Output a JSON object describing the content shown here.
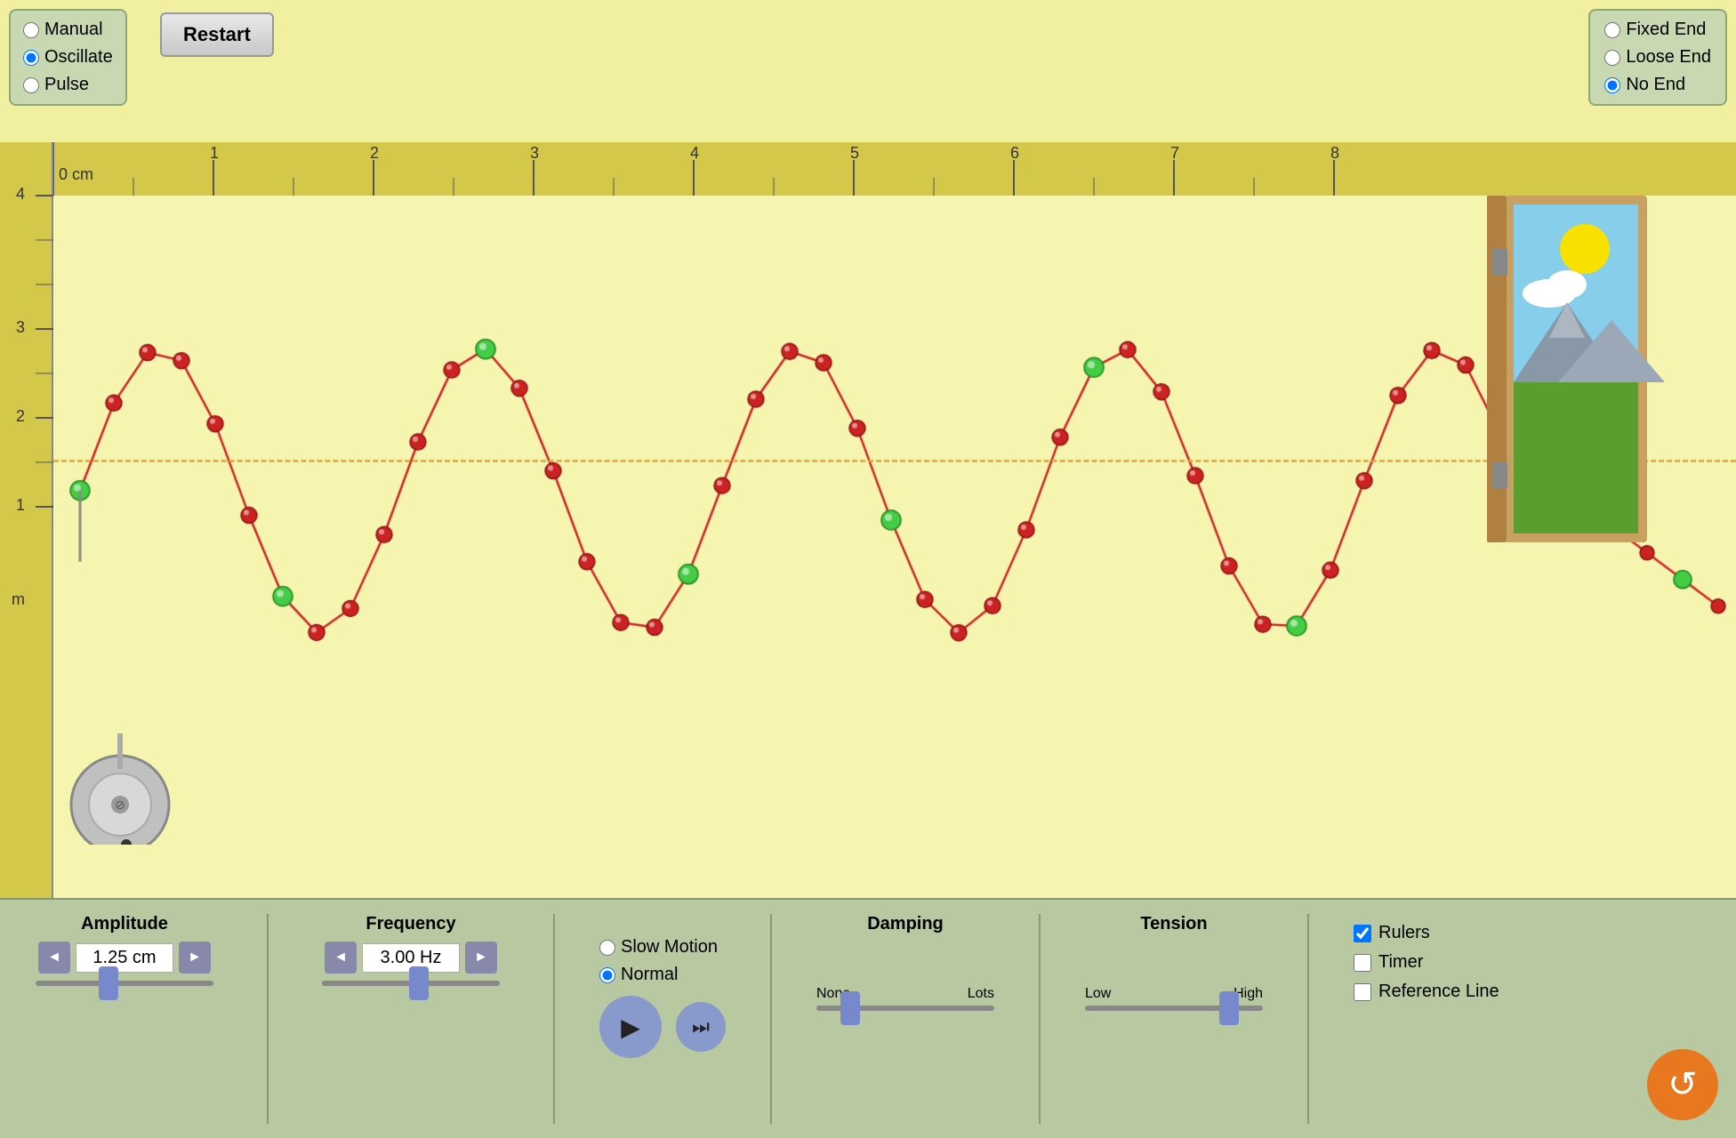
{
  "topLeft": {
    "options": [
      {
        "label": "Manual",
        "value": "manual",
        "checked": false
      },
      {
        "label": "Oscillate",
        "value": "oscillate",
        "checked": true
      },
      {
        "label": "Pulse",
        "value": "pulse",
        "checked": false
      }
    ]
  },
  "restart": {
    "label": "Restart"
  },
  "topRight": {
    "options": [
      {
        "label": "Fixed End",
        "value": "fixed",
        "checked": false
      },
      {
        "label": "Loose End",
        "value": "loose",
        "checked": false
      },
      {
        "label": "No End",
        "value": "noend",
        "checked": true
      }
    ]
  },
  "speed": {
    "options": [
      {
        "label": "Slow Motion",
        "value": "slow",
        "checked": false
      },
      {
        "label": "Normal",
        "value": "normal",
        "checked": true
      }
    ]
  },
  "amplitude": {
    "label": "Amplitude",
    "value": "1.25 cm",
    "decrement": "◄",
    "increment": "►"
  },
  "frequency": {
    "label": "Frequency",
    "value": "3.00 Hz",
    "decrement": "◄",
    "increment": "►"
  },
  "damping": {
    "label": "Damping",
    "minLabel": "None",
    "maxLabel": "Lots",
    "value": 15
  },
  "tension": {
    "label": "Tension",
    "minLabel": "Low",
    "maxLabel": "High",
    "value": 85
  },
  "checkboxes": {
    "rulers": {
      "label": "Rulers",
      "checked": true
    },
    "timer": {
      "label": "Timer",
      "checked": false
    },
    "referenceLine": {
      "label": "Reference Line",
      "checked": false
    }
  },
  "ruler": {
    "marks": [
      "0 cm",
      "1",
      "2",
      "3",
      "4",
      "5",
      "6",
      "7",
      "8"
    ],
    "vMarks": [
      "m",
      "1",
      "2",
      "3",
      "4"
    ]
  },
  "resetIcon": "↺",
  "playIcon": "▶",
  "stepIcon": "⏭"
}
